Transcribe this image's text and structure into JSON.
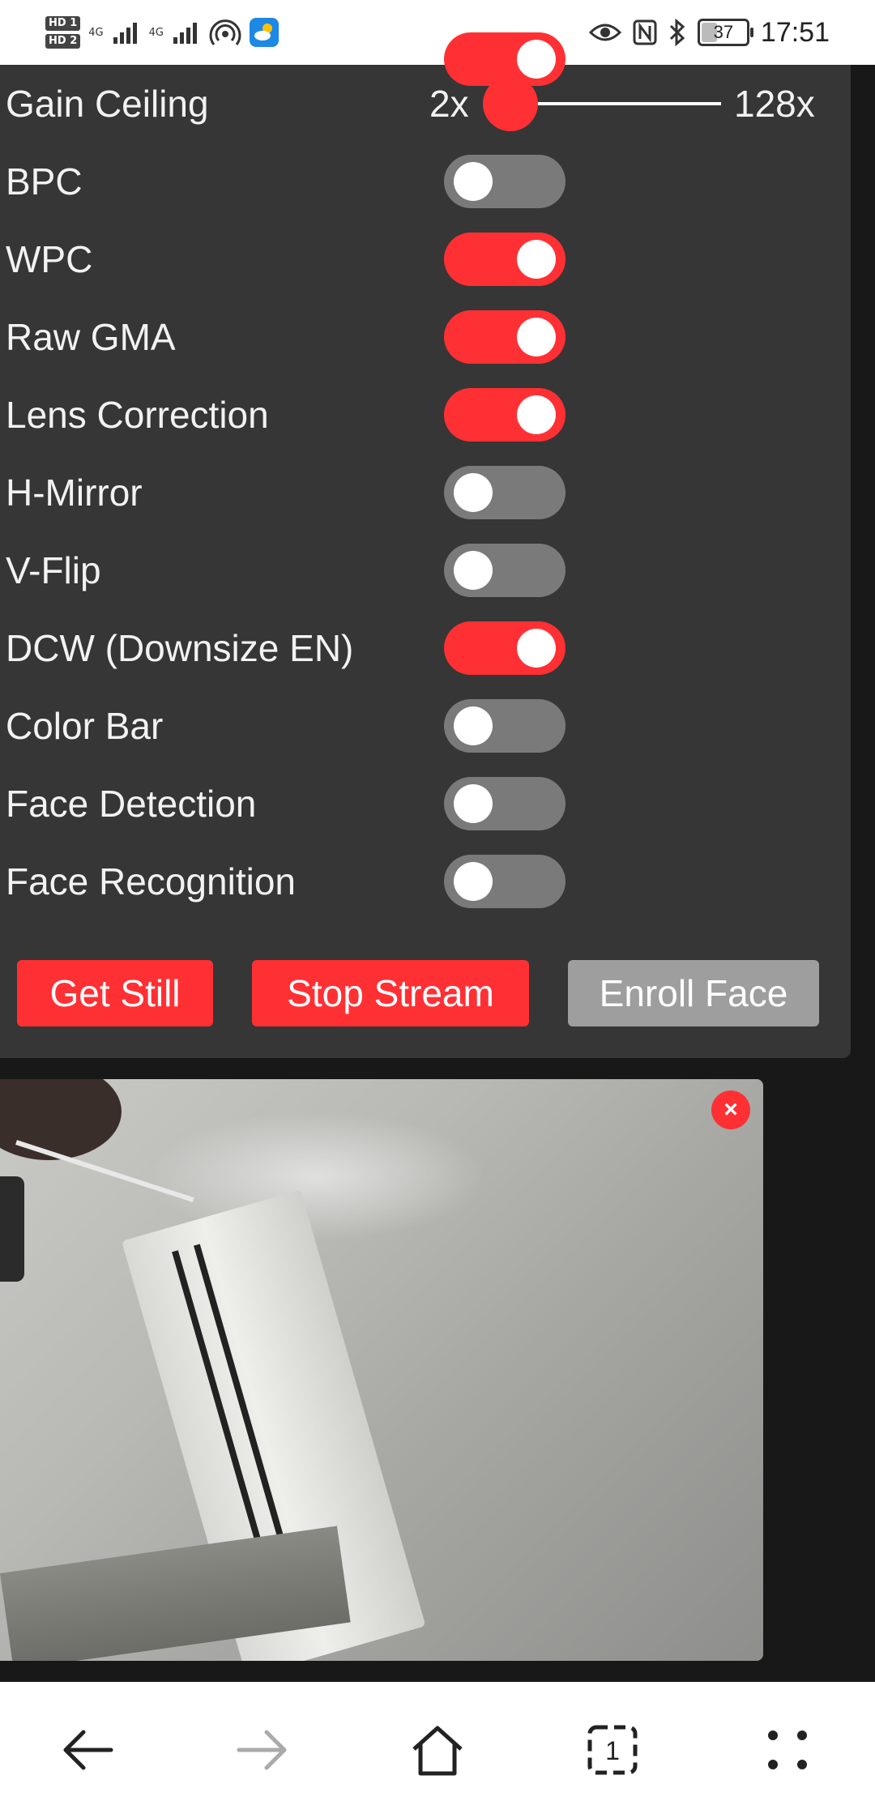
{
  "status_bar": {
    "sim1_badge": "HD 1",
    "sim2_badge": "HD 2",
    "sim1_network": "4G",
    "sim2_network": "4G",
    "battery_level": "37",
    "battery_fraction": 0.37,
    "time": "17:51"
  },
  "settings": {
    "gain_ceiling": {
      "label": "Gain Ceiling",
      "min_label": "2x",
      "max_label": "128x",
      "value_fraction": 0.0
    },
    "toggles": [
      {
        "key": "bpc",
        "label": "BPC",
        "on": false
      },
      {
        "key": "wpc",
        "label": "WPC",
        "on": true
      },
      {
        "key": "raw-gma",
        "label": "Raw GMA",
        "on": true
      },
      {
        "key": "lens-correction",
        "label": "Lens Correction",
        "on": true
      },
      {
        "key": "h-mirror",
        "label": "H-Mirror",
        "on": false
      },
      {
        "key": "v-flip",
        "label": "V-Flip",
        "on": false
      },
      {
        "key": "dcw",
        "label": "DCW (Downsize EN)",
        "on": true
      },
      {
        "key": "color-bar",
        "label": "Color Bar",
        "on": false
      },
      {
        "key": "face-detection",
        "label": "Face Detection",
        "on": false
      },
      {
        "key": "face-recognition",
        "label": "Face Recognition",
        "on": false
      }
    ]
  },
  "buttons": {
    "get_still": "Get Still",
    "stop_stream": "Stop Stream",
    "enroll_face": "Enroll Face"
  },
  "camera": {
    "close_symbol": "×"
  },
  "nav_tab_count": "1",
  "colors": {
    "accent": "#ff3034",
    "panel": "#363636",
    "switch_off": "#7a7a7a",
    "disabled_button": "#9e9e9e"
  }
}
